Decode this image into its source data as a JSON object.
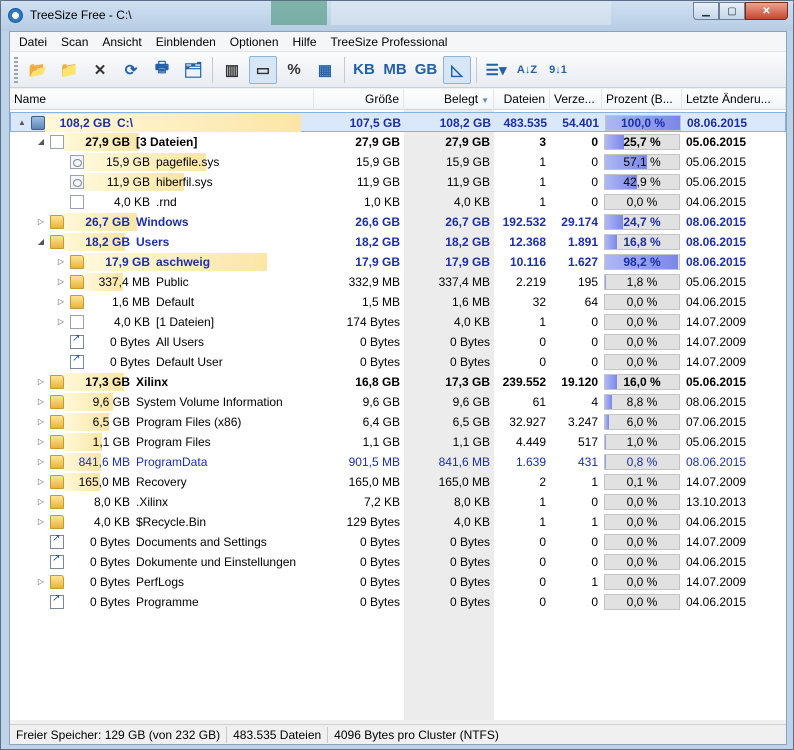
{
  "window": {
    "title": "TreeSize Free - C:\\",
    "controls": [
      "minimize",
      "maximize",
      "close"
    ]
  },
  "menu": [
    "Datei",
    "Scan",
    "Ansicht",
    "Einblenden",
    "Optionen",
    "Hilfe",
    "TreeSize Professional"
  ],
  "toolbar": {
    "buttons": [
      {
        "name": "choose-directory-icon",
        "glyph": "📂"
      },
      {
        "name": "scan-folder-icon",
        "glyph": "📁"
      },
      {
        "name": "stop-icon",
        "glyph": "✕"
      },
      {
        "name": "refresh-icon",
        "glyph": "⟳"
      },
      {
        "name": "print-icon",
        "glyph": "🖶"
      },
      {
        "name": "explorer-icon",
        "glyph": "🗂"
      },
      {
        "name": "columns-icon",
        "glyph": "▥"
      },
      {
        "name": "size-mode-icon",
        "glyph": "▭"
      },
      {
        "name": "percent-mode-icon",
        "glyph": "%"
      },
      {
        "name": "file-count-icon",
        "glyph": "▦"
      },
      {
        "name": "kb-unit-icon",
        "glyph": "KB"
      },
      {
        "name": "mb-unit-icon",
        "glyph": "MB"
      },
      {
        "name": "gb-unit-icon",
        "glyph": "GB"
      },
      {
        "name": "auto-unit-icon",
        "glyph": "◺"
      },
      {
        "name": "view-options-icon",
        "glyph": "☰▾"
      },
      {
        "name": "sort-alpha-icon",
        "glyph": "A↓Z"
      },
      {
        "name": "sort-size-icon",
        "glyph": "9↓1"
      }
    ]
  },
  "columns": [
    "Name",
    "Größe",
    "Belegt",
    "Dateien",
    "Verze...",
    "Prozent (B...",
    "Letzte Änderu..."
  ],
  "rows": [
    {
      "level": 0,
      "exp": "▲",
      "icon": "drive",
      "size": "108,2 GB",
      "name": "C:\\",
      "bar": 1.0,
      "groesse": "107,5 GB",
      "belegt": "108,2 GB",
      "dateien": "483.535",
      "verz": "54.401",
      "pct": 100.0,
      "pct_text": "100,0 %",
      "date": "08.06.2015",
      "style": "navy",
      "sel": true
    },
    {
      "level": 1,
      "exp": "◢",
      "icon": "file",
      "size": "27,9 GB",
      "name": "[3 Dateien]",
      "bar": 0.258,
      "groesse": "27,9 GB",
      "belegt": "27,9 GB",
      "dateien": "3",
      "verz": "0",
      "pct": 25.7,
      "pct_text": "25,7 %",
      "date": "05.06.2015",
      "style": "b"
    },
    {
      "level": 2,
      "exp": "",
      "icon": "sysfile",
      "size": "15,9 GB",
      "name": "pagefile.sys",
      "bar": 0.571,
      "groesse": "15,9 GB",
      "belegt": "15,9 GB",
      "dateien": "1",
      "verz": "0",
      "pct": 57.1,
      "pct_text": "57,1 %",
      "date": "05.06.2015",
      "style": ""
    },
    {
      "level": 2,
      "exp": "",
      "icon": "sysfile",
      "size": "11,9 GB",
      "name": "hiberfil.sys",
      "bar": 0.429,
      "groesse": "11,9 GB",
      "belegt": "11,9 GB",
      "dateien": "1",
      "verz": "0",
      "pct": 42.9,
      "pct_text": "42,9 %",
      "date": "05.06.2015",
      "style": ""
    },
    {
      "level": 2,
      "exp": "",
      "icon": "file",
      "size": "4,0 KB",
      "name": ".rnd",
      "bar": 0,
      "groesse": "1,0 KB",
      "belegt": "4,0 KB",
      "dateien": "1",
      "verz": "0",
      "pct": 0.0,
      "pct_text": "0,0 %",
      "date": "04.06.2015",
      "style": ""
    },
    {
      "level": 1,
      "exp": "▷",
      "icon": "folder",
      "size": "26,7 GB",
      "name": "Windows",
      "bar": 0.247,
      "groesse": "26,6 GB",
      "belegt": "26,7 GB",
      "dateien": "192.532",
      "verz": "29.174",
      "pct": 24.7,
      "pct_text": "24,7 %",
      "date": "08.06.2015",
      "style": "navy"
    },
    {
      "level": 1,
      "exp": "◢",
      "icon": "folder",
      "size": "18,2 GB",
      "name": "Users",
      "bar": 0.168,
      "groesse": "18,2 GB",
      "belegt": "18,2 GB",
      "dateien": "12.368",
      "verz": "1.891",
      "pct": 16.8,
      "pct_text": "16,8 %",
      "date": "08.06.2015",
      "style": "navy"
    },
    {
      "level": 2,
      "exp": "▷",
      "icon": "folder",
      "size": "17,9 GB",
      "name": "aschweig",
      "bar": 0.982,
      "groesse": "17,9 GB",
      "belegt": "17,9 GB",
      "dateien": "10.116",
      "verz": "1.627",
      "pct": 98.2,
      "pct_text": "98,2 %",
      "date": "08.06.2015",
      "style": "navy"
    },
    {
      "level": 2,
      "exp": "▷",
      "icon": "folder",
      "size": "337,4 MB",
      "name": "Public",
      "bar": 0.018,
      "groesse": "332,9 MB",
      "belegt": "337,4 MB",
      "dateien": "2.219",
      "verz": "195",
      "pct": 1.8,
      "pct_text": "1,8 %",
      "date": "05.06.2015",
      "style": ""
    },
    {
      "level": 2,
      "exp": "▷",
      "icon": "folder",
      "size": "1,6 MB",
      "name": "Default",
      "bar": 0,
      "groesse": "1,5 MB",
      "belegt": "1,6 MB",
      "dateien": "32",
      "verz": "64",
      "pct": 0.0,
      "pct_text": "0,0 %",
      "date": "04.06.2015",
      "style": ""
    },
    {
      "level": 2,
      "exp": "▷",
      "icon": "file",
      "size": "4,0 KB",
      "name": "[1 Dateien]",
      "bar": 0,
      "groesse": "174 Bytes",
      "belegt": "4,0 KB",
      "dateien": "1",
      "verz": "0",
      "pct": 0.0,
      "pct_text": "0,0 %",
      "date": "14.07.2009",
      "style": ""
    },
    {
      "level": 2,
      "exp": "",
      "icon": "link",
      "size": "0 Bytes",
      "name": "All Users",
      "bar": 0,
      "groesse": "0 Bytes",
      "belegt": "0 Bytes",
      "dateien": "0",
      "verz": "0",
      "pct": 0.0,
      "pct_text": "0,0 %",
      "date": "14.07.2009",
      "style": ""
    },
    {
      "level": 2,
      "exp": "",
      "icon": "link",
      "size": "0 Bytes",
      "name": "Default User",
      "bar": 0,
      "groesse": "0 Bytes",
      "belegt": "0 Bytes",
      "dateien": "0",
      "verz": "0",
      "pct": 0.0,
      "pct_text": "0,0 %",
      "date": "14.07.2009",
      "style": ""
    },
    {
      "level": 1,
      "exp": "▷",
      "icon": "folder",
      "size": "17,3 GB",
      "name": "Xilinx",
      "bar": 0.16,
      "groesse": "16,8 GB",
      "belegt": "17,3 GB",
      "dateien": "239.552",
      "verz": "19.120",
      "pct": 16.0,
      "pct_text": "16,0 %",
      "date": "05.06.2015",
      "style": "b"
    },
    {
      "level": 1,
      "exp": "▷",
      "icon": "folder",
      "size": "9,6 GB",
      "name": "System Volume Information",
      "bar": 0.088,
      "groesse": "9,6 GB",
      "belegt": "9,6 GB",
      "dateien": "61",
      "verz": "4",
      "pct": 8.8,
      "pct_text": "8,8 %",
      "date": "08.06.2015",
      "style": ""
    },
    {
      "level": 1,
      "exp": "▷",
      "icon": "folder",
      "size": "6,5 GB",
      "name": "Program Files (x86)",
      "bar": 0.06,
      "groesse": "6,4 GB",
      "belegt": "6,5 GB",
      "dateien": "32.927",
      "verz": "3.247",
      "pct": 6.0,
      "pct_text": "6,0 %",
      "date": "07.06.2015",
      "style": ""
    },
    {
      "level": 1,
      "exp": "▷",
      "icon": "folder",
      "size": "1,1 GB",
      "name": "Program Files",
      "bar": 0.01,
      "groesse": "1,1 GB",
      "belegt": "1,1 GB",
      "dateien": "4.449",
      "verz": "517",
      "pct": 1.0,
      "pct_text": "1,0 %",
      "date": "05.06.2015",
      "style": ""
    },
    {
      "level": 1,
      "exp": "▷",
      "icon": "folder",
      "size": "841,6 MB",
      "name": "ProgramData",
      "bar": 0.008,
      "groesse": "901,5 MB",
      "belegt": "841,6 MB",
      "dateien": "1.639",
      "verz": "431",
      "pct": 0.8,
      "pct_text": "0,8 %",
      "date": "08.06.2015",
      "style": "blue"
    },
    {
      "level": 1,
      "exp": "▷",
      "icon": "folder",
      "size": "165,0 MB",
      "name": "Recovery",
      "bar": 0.001,
      "groesse": "165,0 MB",
      "belegt": "165,0 MB",
      "dateien": "2",
      "verz": "1",
      "pct": 0.1,
      "pct_text": "0,1 %",
      "date": "14.07.2009",
      "style": ""
    },
    {
      "level": 1,
      "exp": "▷",
      "icon": "folder",
      "size": "8,0 KB",
      "name": ".Xilinx",
      "bar": 0,
      "groesse": "7,2 KB",
      "belegt": "8,0 KB",
      "dateien": "1",
      "verz": "0",
      "pct": 0.0,
      "pct_text": "0,0 %",
      "date": "13.10.2013",
      "style": ""
    },
    {
      "level": 1,
      "exp": "▷",
      "icon": "folder",
      "size": "4,0 KB",
      "name": "$Recycle.Bin",
      "bar": 0,
      "groesse": "129 Bytes",
      "belegt": "4,0 KB",
      "dateien": "1",
      "verz": "1",
      "pct": 0.0,
      "pct_text": "0,0 %",
      "date": "04.06.2015",
      "style": ""
    },
    {
      "level": 1,
      "exp": "",
      "icon": "link",
      "size": "0 Bytes",
      "name": "Documents and Settings",
      "bar": 0,
      "groesse": "0 Bytes",
      "belegt": "0 Bytes",
      "dateien": "0",
      "verz": "0",
      "pct": 0.0,
      "pct_text": "0,0 %",
      "date": "14.07.2009",
      "style": ""
    },
    {
      "level": 1,
      "exp": "",
      "icon": "link",
      "size": "0 Bytes",
      "name": "Dokumente und Einstellungen",
      "bar": 0,
      "groesse": "0 Bytes",
      "belegt": "0 Bytes",
      "dateien": "0",
      "verz": "0",
      "pct": 0.0,
      "pct_text": "0,0 %",
      "date": "04.06.2015",
      "style": ""
    },
    {
      "level": 1,
      "exp": "▷",
      "icon": "folder",
      "size": "0 Bytes",
      "name": "PerfLogs",
      "bar": 0,
      "groesse": "0 Bytes",
      "belegt": "0 Bytes",
      "dateien": "0",
      "verz": "1",
      "pct": 0.0,
      "pct_text": "0,0 %",
      "date": "14.07.2009",
      "style": ""
    },
    {
      "level": 1,
      "exp": "",
      "icon": "link",
      "size": "0 Bytes",
      "name": "Programme",
      "bar": 0,
      "groesse": "0 Bytes",
      "belegt": "0 Bytes",
      "dateien": "0",
      "verz": "0",
      "pct": 0.0,
      "pct_text": "0,0 %",
      "date": "04.06.2015",
      "style": ""
    }
  ],
  "status": {
    "free_space": "Freier Speicher: 129 GB  (von 232 GB)",
    "files": "483.535  Dateien",
    "cluster": "4096 Bytes pro Cluster (NTFS)"
  }
}
